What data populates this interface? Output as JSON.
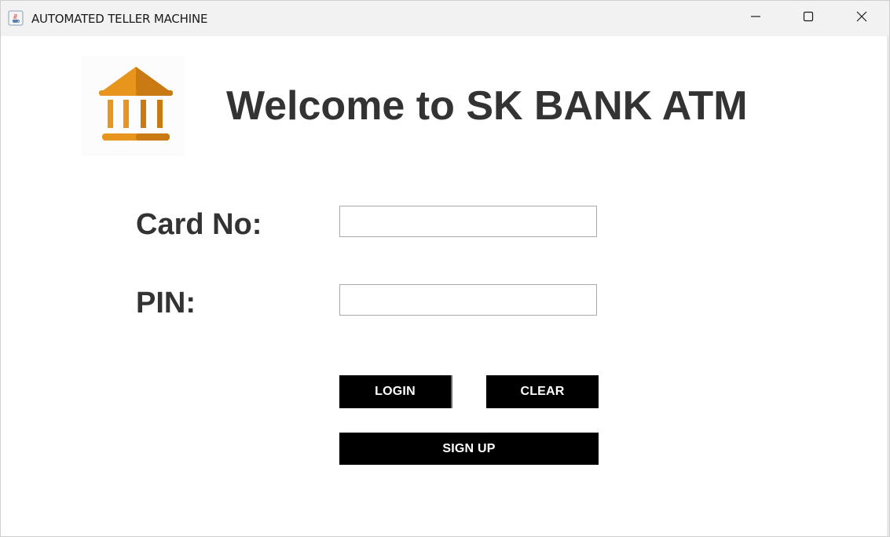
{
  "window": {
    "title": "AUTOMATED TELLER MACHINE",
    "icons": {
      "app": "java-cup-icon",
      "minimize": "minimize-icon",
      "maximize": "maximize-icon",
      "close": "close-icon"
    }
  },
  "header": {
    "logo": "bank-building-icon",
    "welcome": "Welcome to SK BANK ATM"
  },
  "form": {
    "card_label": "Card No:",
    "card_value": "",
    "pin_label": "PIN:",
    "pin_value": ""
  },
  "buttons": {
    "login": "LOGIN",
    "clear": "CLEAR",
    "signup": "SIGN UP"
  },
  "colors": {
    "logo_orange": "#E8951E",
    "logo_dark": "#C97A12",
    "button_bg": "#000000",
    "text_dark": "#333333"
  }
}
